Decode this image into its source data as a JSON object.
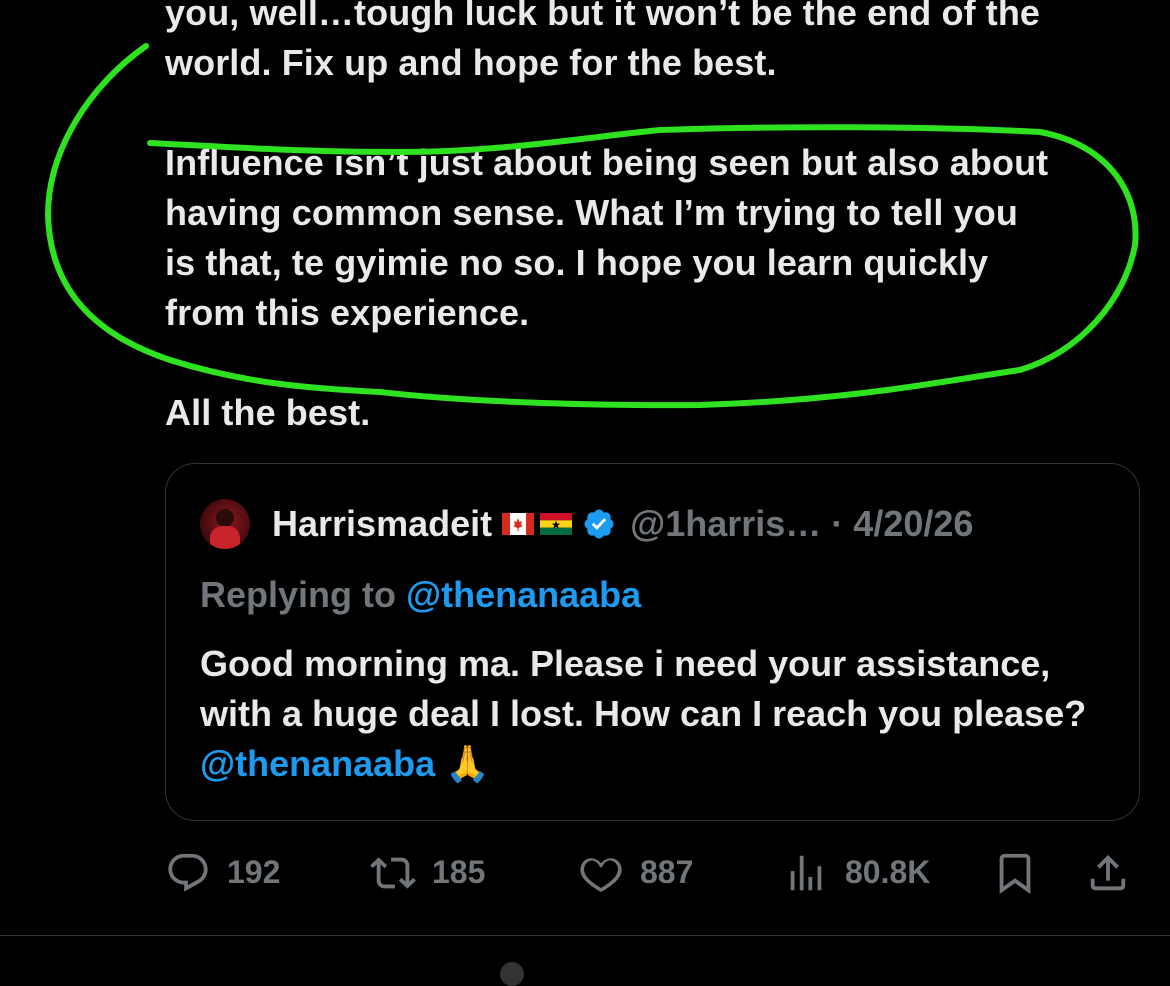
{
  "tweet": {
    "lines": [
      "you, well…tough luck but it won’t be the end of the",
      "world. Fix up and hope for the best.",
      "",
      "Influence isn’t just about being seen but also about",
      "having common sense. What I’m trying to tell you",
      "is that, te gyimie no so. I hope you learn quickly",
      "from this experience.",
      "",
      "All the best."
    ]
  },
  "highlight": {
    "color": "#2ee21f"
  },
  "quote": {
    "display_name": "Harrismadeit",
    "handle": "@1harris…",
    "separator": "·",
    "date": "4/20/26",
    "replying_prefix": "Replying to",
    "replying_handle": "@thenanaaba",
    "body_text": "Good morning ma. Please i need your assistance, with a huge deal I lost. How can I reach you please?",
    "body_mention": "@thenanaaba",
    "emoji": "🙏",
    "flags": [
      "canada-flag",
      "ghana-flag"
    ],
    "verified_icon": "verified-badge-icon"
  },
  "actions": {
    "replies": "192",
    "reposts": "185",
    "likes": "887",
    "views": "80.8K"
  },
  "colors": {
    "background": "#000000",
    "text": "#e7e9ea",
    "muted": "#71767b",
    "accent": "#1d9bf0",
    "border": "#2f3336"
  }
}
